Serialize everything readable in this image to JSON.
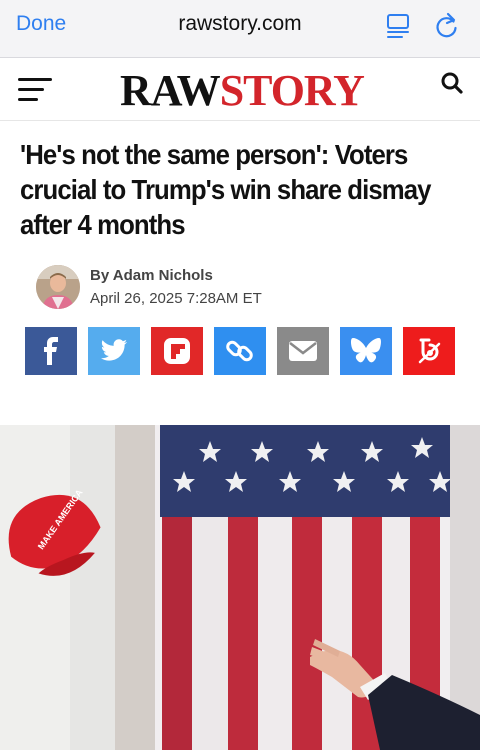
{
  "browser": {
    "done_label": "Done",
    "url": "rawstory.com",
    "icons": [
      "reader-icon",
      "reload-icon"
    ],
    "accent_color": "#2f7ff0"
  },
  "site": {
    "logo_part1": "RAW",
    "logo_part2": "STORY",
    "logo_color_primary": "#111111",
    "logo_color_accent": "#d3252b",
    "icons": [
      "menu-icon",
      "search-icon"
    ]
  },
  "article": {
    "headline": "'He's not the same person': Voters crucial to Trump's win share dismay after 4 months",
    "author": "By Adam Nichols",
    "date": "April 26, 2025 7:28AM ET"
  },
  "share_buttons": [
    {
      "name": "facebook",
      "icon": "facebook-icon",
      "color": "#3b5998"
    },
    {
      "name": "twitter",
      "icon": "twitter-icon",
      "color": "#55acee"
    },
    {
      "name": "flipboard",
      "icon": "flipboard-icon",
      "color": "#e12828"
    },
    {
      "name": "copy-link",
      "icon": "link-icon",
      "color": "#2f8ff0"
    },
    {
      "name": "email",
      "icon": "email-icon",
      "color": "#8a8a8a"
    },
    {
      "name": "bluesky",
      "icon": "bluesky-icon",
      "color": "#3a8ff0"
    },
    {
      "name": "other",
      "icon": "share-icon",
      "color": "#ee1c1c"
    }
  ],
  "photo": {
    "hat_text": "MAKE AMERICA"
  }
}
